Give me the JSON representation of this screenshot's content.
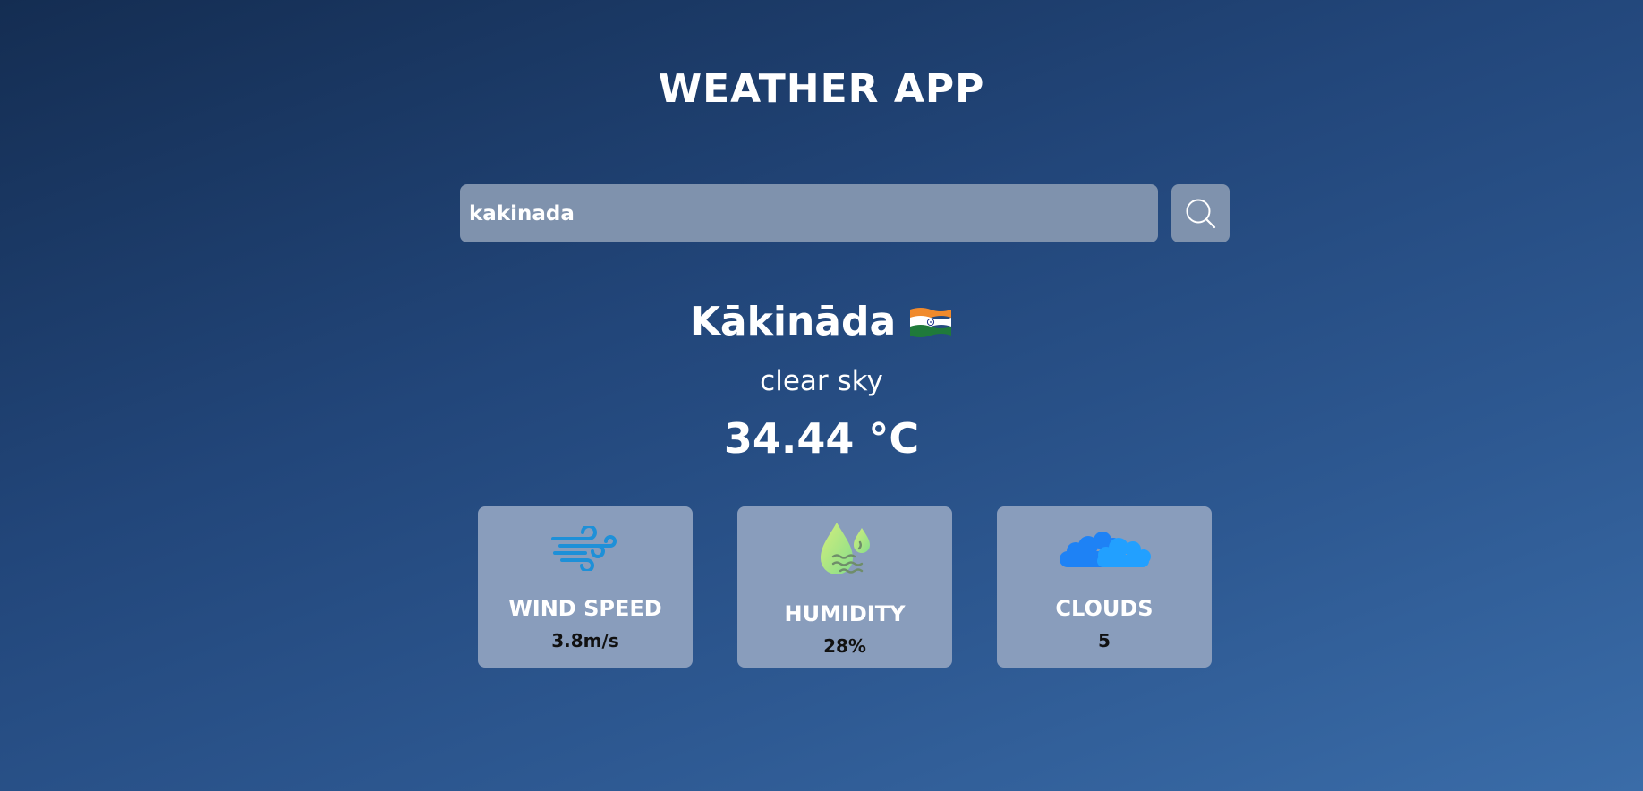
{
  "header": {
    "title": "WEATHER APP"
  },
  "search": {
    "value": "kakinada",
    "placeholder": ""
  },
  "weather": {
    "city": "Kākināda",
    "country_flag": "india-flag",
    "description": "clear sky",
    "temperature": "34.44 °C"
  },
  "cards": [
    {
      "icon": "wind-icon",
      "label": "WIND SPEED",
      "value": "3.8m/s"
    },
    {
      "icon": "humidity-icon",
      "label": "HUMIDITY",
      "value": "28%"
    },
    {
      "icon": "clouds-icon",
      "label": "CLOUDS",
      "value": "5"
    }
  ],
  "colors": {
    "field_bg": "#7f92ad",
    "card_bg": "#899dbc",
    "wind_icon": "#1e90d8",
    "humidity_icon": "#a8e070",
    "clouds_icon": "#1e8cff"
  }
}
